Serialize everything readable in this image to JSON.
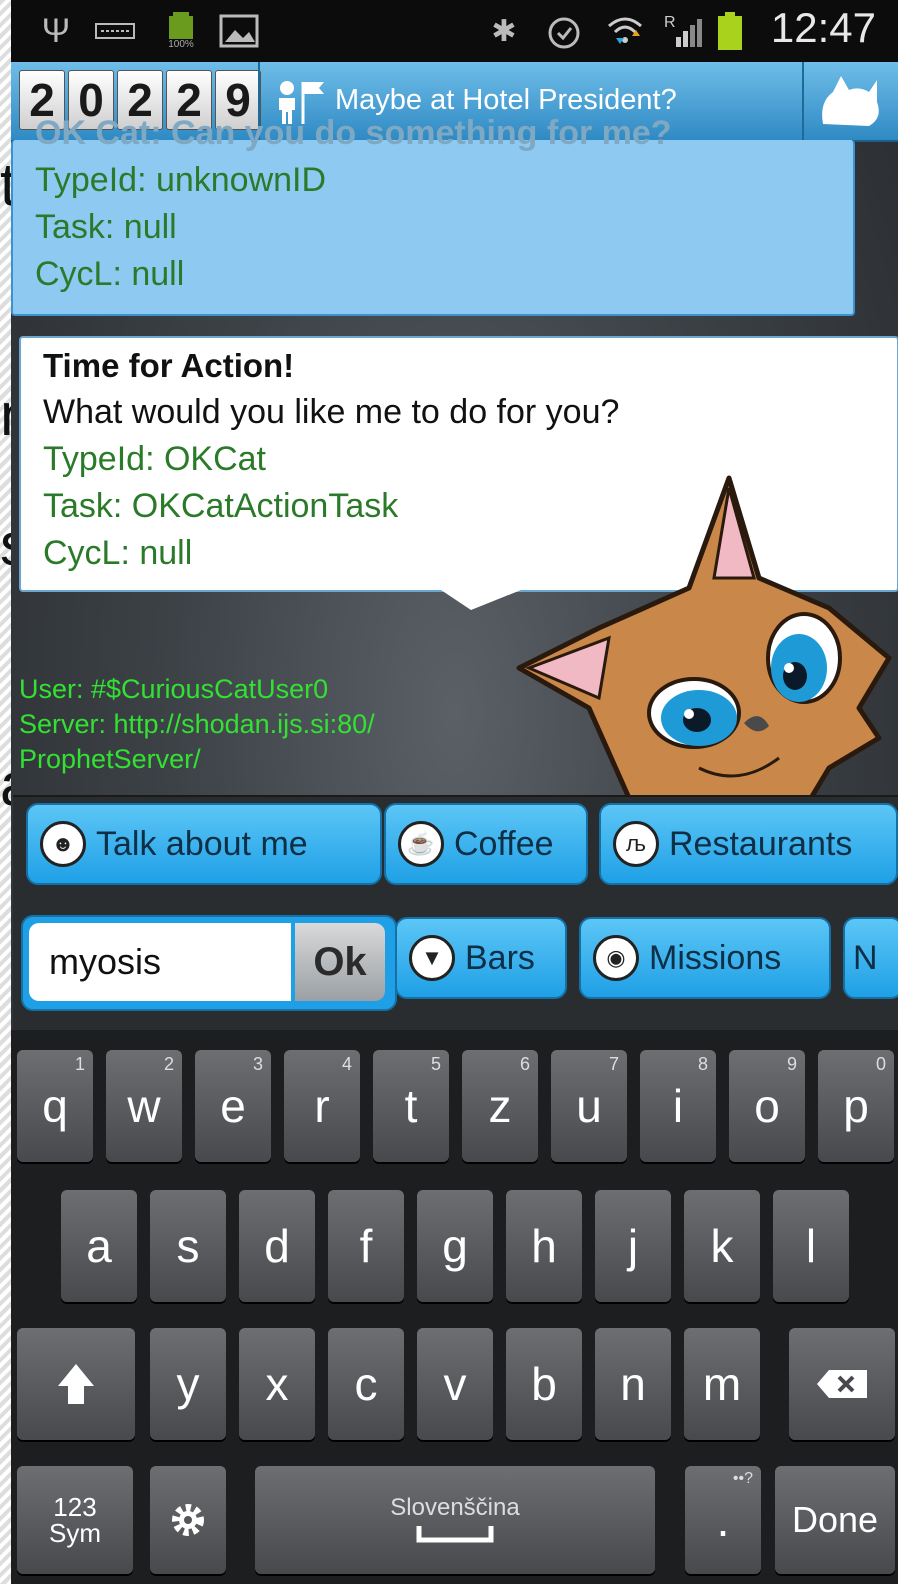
{
  "slide_fragments": [
    "t",
    "n",
    "s",
    "a"
  ],
  "status_bar": {
    "clock": "12:47",
    "battery_small_label": "100%",
    "signal_label": "R"
  },
  "header": {
    "counter_digits": [
      "2",
      "0",
      "2",
      "2",
      "9"
    ],
    "location_text": "Maybe at Hotel President?"
  },
  "messages": [
    {
      "title": "OK Cat: Can you do something for me?",
      "typeid": "TypeId: unknownID",
      "task": "Task: null",
      "cycl": "CycL: null"
    },
    {
      "title": "Time for Action!",
      "body": "What would you like me to do for you?",
      "typeid": "TypeId: OKCat",
      "task": "Task: OKCatActionTask",
      "cycl": "CycL: null"
    }
  ],
  "user_info": {
    "user": "User: #$CuriousCatUser0",
    "server_line1": "Server: http://shodan.ijs.si:80/",
    "server_line2": "ProphetServer/"
  },
  "suggestions": {
    "row1": [
      {
        "label": "Talk about me",
        "icon": "cat-icon"
      },
      {
        "label": "Coffee",
        "icon": "coffee-icon"
      },
      {
        "label": "Restaurants",
        "icon": "fork-knife-icon"
      }
    ],
    "row2": [
      {
        "label": "Bars",
        "icon": "cocktail-icon"
      },
      {
        "label": "Missions",
        "icon": "spiral-icon"
      },
      {
        "label": "N",
        "icon": ""
      }
    ]
  },
  "input": {
    "value": "myosis",
    "ok_label": "Ok"
  },
  "keyboard": {
    "row1": [
      [
        "q",
        "1"
      ],
      [
        "w",
        "2"
      ],
      [
        "e",
        "3"
      ],
      [
        "r",
        "4"
      ],
      [
        "t",
        "5"
      ],
      [
        "z",
        "6"
      ],
      [
        "u",
        "7"
      ],
      [
        "i",
        "8"
      ],
      [
        "o",
        "9"
      ],
      [
        "p",
        "0"
      ]
    ],
    "row2": [
      "a",
      "s",
      "d",
      "f",
      "g",
      "h",
      "j",
      "k",
      "l"
    ],
    "row3": [
      "y",
      "x",
      "c",
      "v",
      "b",
      "n",
      "m"
    ],
    "sym_label_1": "123",
    "sym_label_2": "Sym",
    "language": "Slovenščina",
    "period": ".",
    "period_hint": "••?",
    "done_label": "Done"
  },
  "colors": {
    "header_blue": "#2f8ac4",
    "chip_blue": "#1fa0e6",
    "info_green": "#32e132",
    "message_green": "#2a7a2a"
  }
}
